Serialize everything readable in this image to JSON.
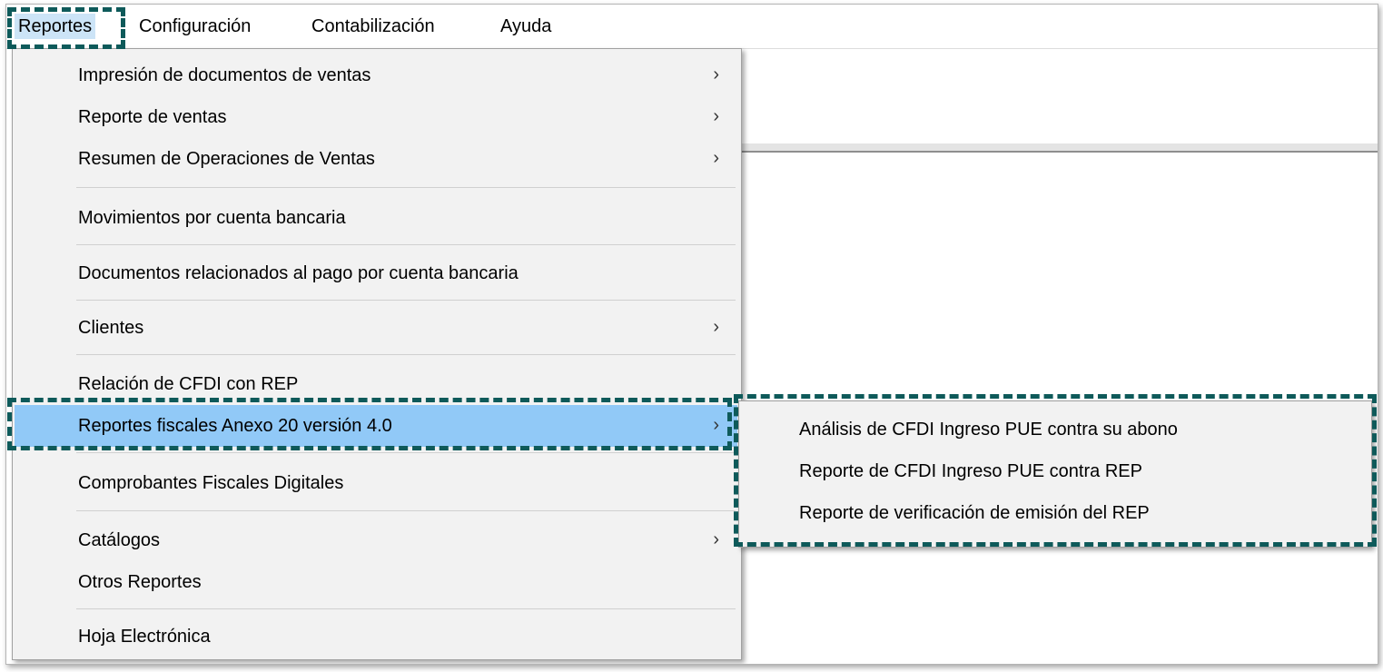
{
  "menubar": {
    "items": [
      {
        "label": "Reportes"
      },
      {
        "label": "Configuración"
      },
      {
        "label": "Contabilización"
      },
      {
        "label": "Ayuda"
      }
    ]
  },
  "dropdown": {
    "items": [
      {
        "label": "Impresión de documentos de ventas",
        "arrow": "›"
      },
      {
        "label": "Reporte de ventas",
        "arrow": "›"
      },
      {
        "label": "Resumen de Operaciones de Ventas",
        "arrow": "›"
      },
      {
        "label": "Movimientos por cuenta bancaria"
      },
      {
        "label": "Documentos relacionados al pago por cuenta bancaria"
      },
      {
        "label": "Clientes",
        "arrow": "›"
      },
      {
        "label": "Relación de CFDI con REP"
      },
      {
        "label": "Reportes fiscales Anexo 20 versión 4.0",
        "arrow": "›"
      },
      {
        "label": "Comprobantes Fiscales Digitales"
      },
      {
        "label": "Catálogos",
        "arrow": "›"
      },
      {
        "label": "Otros Reportes"
      },
      {
        "label": "Hoja Electrónica"
      }
    ]
  },
  "submenu": {
    "items": [
      {
        "label": "Análisis de CFDI Ingreso PUE contra su abono"
      },
      {
        "label": "Reporte de CFDI Ingreso PUE contra REP"
      },
      {
        "label": "Reporte de verificación de emisión del REP"
      }
    ]
  },
  "colors": {
    "highlight": "#91c9f7",
    "menubar_active": "#cce4f7",
    "menu_background": "#f2f2f2",
    "dashed_annotation": "#0e5a5a"
  }
}
